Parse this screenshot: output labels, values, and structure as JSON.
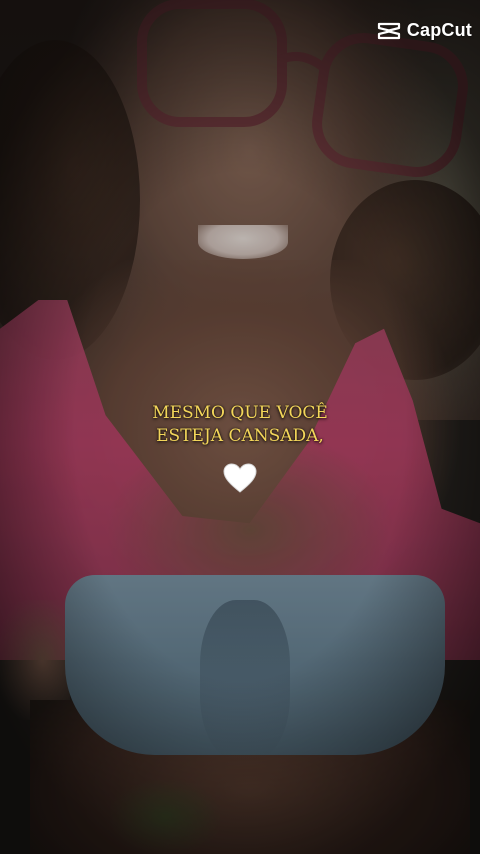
{
  "watermark": {
    "brand": "CapCut",
    "icon": "capcut-logo-icon"
  },
  "caption": {
    "line1": "MESMO QUE VOCÊ",
    "line2": "ESTEJA CANSADA,",
    "color": "#f3d65a"
  },
  "heart": {
    "icon": "white-heart-icon",
    "color": "#ffffff"
  }
}
